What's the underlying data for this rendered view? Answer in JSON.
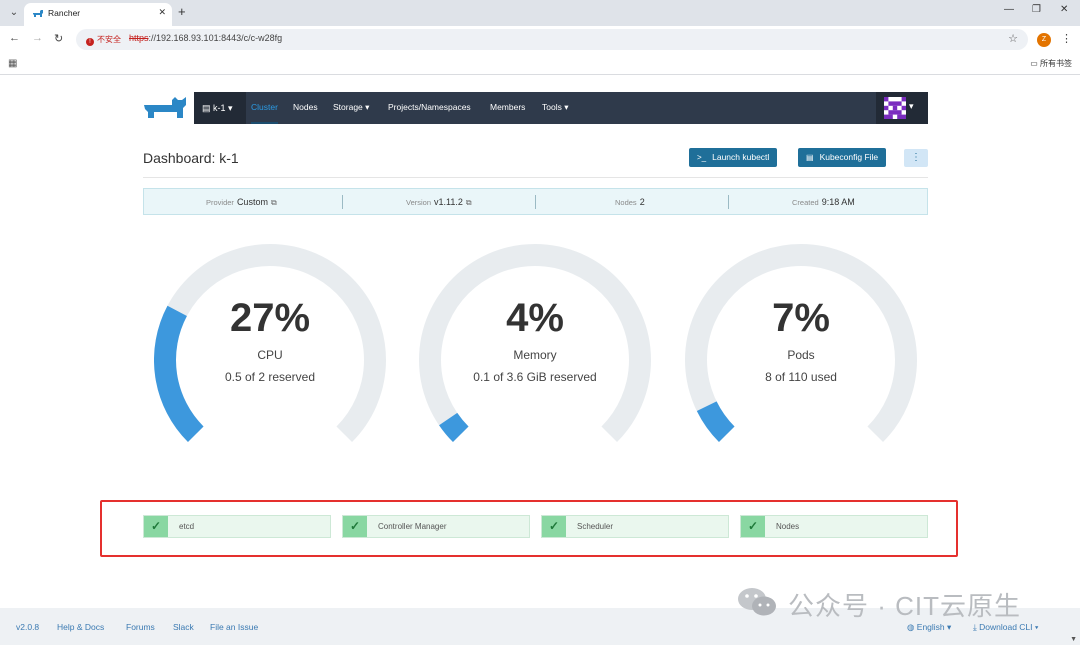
{
  "browser": {
    "tab_title": "Rancher",
    "insecure_label": "不安全",
    "url_scheme": "https",
    "url_rest": "://192.168.93.101:8443/c/c-w28fg",
    "profile_initial": "Z",
    "bookmark_folder": "所有书签"
  },
  "nav": {
    "cluster": "k-1",
    "items": [
      {
        "label": "Cluster",
        "active": true
      },
      {
        "label": "Nodes"
      },
      {
        "label": "Storage ▾"
      },
      {
        "label": "Projects/Namespaces"
      },
      {
        "label": "Members"
      },
      {
        "label": "Tools ▾"
      }
    ]
  },
  "header": {
    "title": "Dashboard: k-1",
    "launch_kubectl": "Launch kubectl",
    "kubeconfig": "Kubeconfig File"
  },
  "info": {
    "provider_label": "Provider",
    "provider_value": "Custom",
    "version_label": "Version",
    "version_value": "v1.11.2",
    "nodes_label": "Nodes",
    "nodes_value": "2",
    "created_label": "Created",
    "created_value": "9:18 AM"
  },
  "gauges": [
    {
      "pct": "27%",
      "name": "CPU",
      "sub": "0.5 of 2 reserved",
      "fraction": 0.27
    },
    {
      "pct": "4%",
      "name": "Memory",
      "sub": "0.1 of 3.6 GiB reserved",
      "fraction": 0.04
    },
    {
      "pct": "7%",
      "name": "Pods",
      "sub": "8 of 110 used",
      "fraction": 0.07
    }
  ],
  "components": [
    {
      "label": "etcd"
    },
    {
      "label": "Controller Manager"
    },
    {
      "label": "Scheduler"
    },
    {
      "label": "Nodes"
    }
  ],
  "footer": {
    "version": "v2.0.8",
    "help": "Help & Docs",
    "forums": "Forums",
    "slack": "Slack",
    "issue": "File an Issue",
    "language": "English",
    "download": "Download CLI"
  },
  "watermark": "公众号 · CIT云原生",
  "colors": {
    "nav_bg": "#2f3a4b",
    "accent": "#2b9be4",
    "gauge_fill": "#3d98dd",
    "gauge_track": "#e8ecef",
    "highlight_border": "#e5302e"
  }
}
